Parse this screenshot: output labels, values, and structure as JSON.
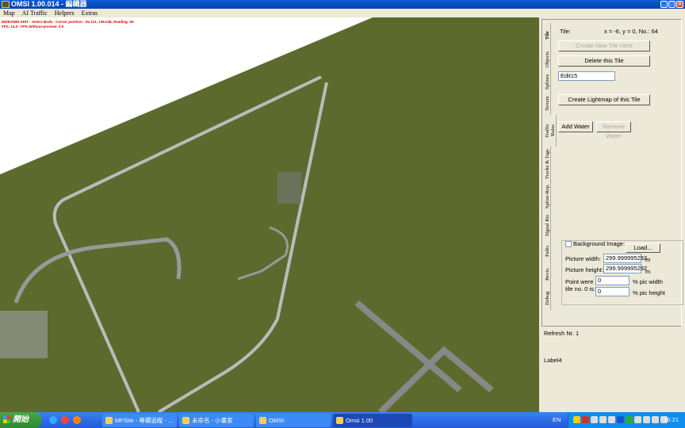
{
  "window": {
    "title": "OMSI 1.00.014 - 編輯器"
  },
  "menu": [
    "Map",
    "AI Traffic",
    "Helpers",
    "Extras"
  ],
  "overlay": {
    "line1": "INDEXWIN EDIT - Select Mode - Cursor position: -91.121, 139.248, Heading: 53",
    "line2": "FPS: 14.0 - FPS Without-preview: 0.0"
  },
  "tabs": [
    "Tile",
    "Objects",
    "Splines",
    "Terrain",
    "Traffic Rules",
    "Tracks & Tags",
    "Spline-Rep.",
    "Signal Rts",
    "Paths",
    "Bevis.",
    "Debug"
  ],
  "tile": {
    "label": "Tile:",
    "coords": "x = -6, y = 0, No.: 64",
    "create_new": "Create New Tile Here",
    "delete": "Delete this Tile",
    "edit_value": "Edit15",
    "create_lightmap": "Create Lightmap of this Tile",
    "add_water": "Add Water",
    "remove_water": "Remove Water"
  },
  "background": {
    "checkbox_label": "Background Image:",
    "checked": false,
    "load": "Load...",
    "width_label": "Picture width:",
    "width_value": "299.999995292",
    "width_unit": "m",
    "height_label": "Picture height:",
    "height_value": "299.999995292",
    "height_unit": "m",
    "point_label_1": "Point were",
    "point_label_2": "tile no. 0 is:",
    "pct_w_value": "0",
    "pct_w_label": "% pic width",
    "pct_h_value": "0",
    "pct_h_label": "% pic height"
  },
  "status": {
    "refresh": "Refresh Nr. 1",
    "label4": "Label4"
  },
  "taskbar": {
    "start": "開始",
    "tasks": [
      "MFSite - 專欄追蹤 - ...",
      "未命名 - 小畫家",
      "OMSI",
      "Omsi 1.00"
    ],
    "lang": "EN",
    "clock": "16:21"
  }
}
